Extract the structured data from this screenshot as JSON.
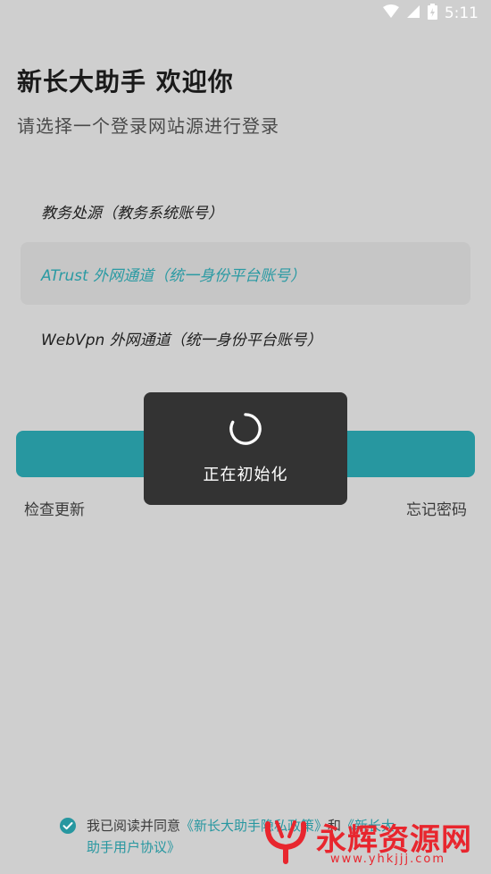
{
  "status_bar": {
    "time": "5:11",
    "icons": [
      "wifi-icon",
      "cellular-signal-icon",
      "battery-charging-icon"
    ]
  },
  "header": {
    "title": "新长大助手 欢迎你",
    "subtitle": "请选择一个登录网站源进行登录"
  },
  "sources": [
    {
      "label": "教务处源（教务系统账号）",
      "selected": false
    },
    {
      "label": "ATrust 外网通道（统一身份平台账号）",
      "selected": true
    },
    {
      "label": "WebVpn 外网通道（统一身份平台账号）",
      "selected": false
    }
  ],
  "actions": {
    "check_update": "检查更新",
    "forgot_password": "忘记密码"
  },
  "loading": {
    "text": "正在初始化"
  },
  "agreement": {
    "checked": true,
    "prefix": "我已阅读并同意",
    "privacy_link": "《新长大助手隐私政策》",
    "conjunction": "和",
    "terms_link": "《新长大助手用户协议》"
  },
  "watermark": {
    "name": "永辉资源网",
    "url": "www.yhkjjj.com"
  },
  "colors": {
    "accent": "#2797a0",
    "background": "#cfcfcf",
    "dialog": "#333333",
    "watermark": "#e8262e"
  }
}
